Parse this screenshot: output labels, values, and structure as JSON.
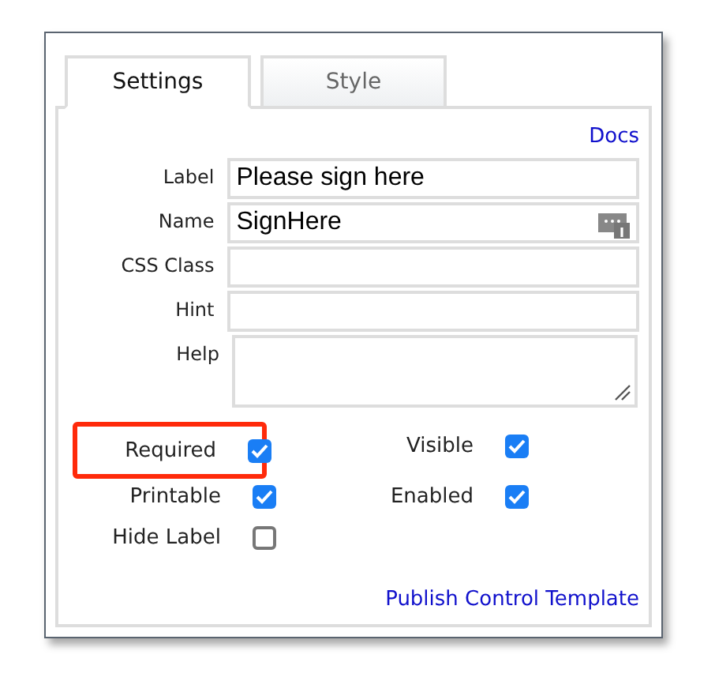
{
  "tabs": [
    {
      "label": "Settings",
      "selected": true
    },
    {
      "label": "Style",
      "selected": false
    }
  ],
  "docs_link": "Docs",
  "fields": [
    {
      "label": "Label",
      "kind": "text",
      "value": "Please sign here"
    },
    {
      "label": "Name",
      "kind": "text-badge",
      "value": "SignHere"
    },
    {
      "label": "CSS Class",
      "kind": "text"
    },
    {
      "label": "Hint",
      "kind": "text"
    },
    {
      "label": "Help",
      "kind": "textarea"
    }
  ],
  "options": [
    {
      "label": "Required",
      "checked": true,
      "highlighted": true
    },
    {
      "label": "Visible",
      "checked": true,
      "highlighted": false
    },
    {
      "label": "Printable",
      "checked": true,
      "highlighted": false
    },
    {
      "label": "Enabled",
      "checked": true,
      "highlighted": false
    },
    {
      "label": "Hide Label",
      "checked": false,
      "highlighted": false
    }
  ],
  "publish_link": "Publish Control Template"
}
